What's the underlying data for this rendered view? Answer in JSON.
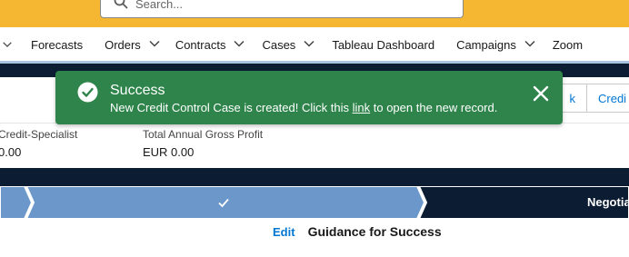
{
  "search": {
    "placeholder": "Search..."
  },
  "nav": {
    "items": [
      {
        "label": "Forecasts",
        "has_menu": false
      },
      {
        "label": "Orders",
        "has_menu": true
      },
      {
        "label": "Contracts",
        "has_menu": true
      },
      {
        "label": "Cases",
        "has_menu": true
      },
      {
        "label": "Tableau Dashboard",
        "has_menu": false
      },
      {
        "label": "Campaigns",
        "has_menu": true
      },
      {
        "label": "Zoom",
        "has_menu": false
      }
    ]
  },
  "header": {
    "buttons": [
      {
        "label": "k"
      },
      {
        "label": "Credi"
      }
    ],
    "fields": [
      {
        "label": "Credit-Specialist",
        "value": "0.00"
      },
      {
        "label": "Total Annual Gross Profit",
        "value": "EUR 0.00"
      }
    ]
  },
  "path": {
    "current_stage": "Negotia"
  },
  "guidance": {
    "edit_label": "Edit",
    "title": "Guidance for Success"
  },
  "toast": {
    "title": "Success",
    "message_before": "New Credit Control Case is created! Click this",
    "link_text": "link",
    "message_after": "to open the new record.",
    "color": "#2e844a"
  },
  "colors": {
    "header_yellow": "#f5b731",
    "path_complete": "#6b97cb",
    "path_current": "#0b1c33",
    "link_blue": "#0176d3"
  }
}
